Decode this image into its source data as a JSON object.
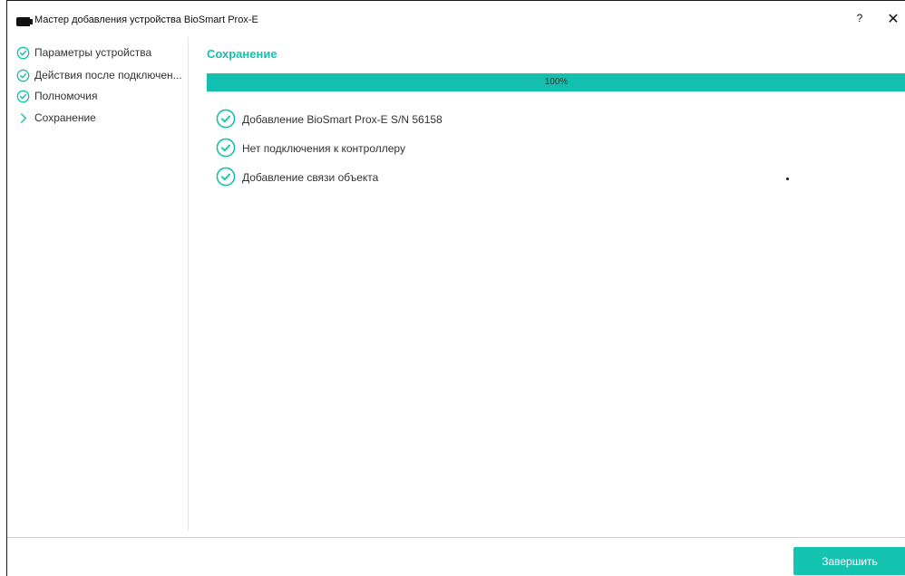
{
  "window": {
    "title": "Мастер добавления устройства BioSmart Prox-E",
    "help_label": "?",
    "close_label": "✕"
  },
  "sidebar": {
    "steps": [
      {
        "label": "Параметры устройства",
        "state": "done",
        "icon": "check-circle-icon"
      },
      {
        "label": "Действия после подключен...",
        "state": "done",
        "icon": "check-circle-icon"
      },
      {
        "label": "Полномочия",
        "state": "done",
        "icon": "check-circle-icon"
      },
      {
        "label": "Сохранение",
        "state": "current",
        "icon": "chevron-right-icon"
      }
    ]
  },
  "main": {
    "section_title": "Сохранение",
    "progress": {
      "value": 100,
      "label": "100%"
    },
    "tasks": [
      {
        "label": "Добавление BioSmart Prox-E S/N 56158",
        "status": "done",
        "icon": "check-circle-icon"
      },
      {
        "label": "Нет подключения к контроллеру",
        "status": "done",
        "icon": "check-circle-icon"
      },
      {
        "label": "Добавление связи объекта",
        "status": "done",
        "icon": "check-circle-icon"
      }
    ]
  },
  "footer": {
    "finish_label": "Завершить"
  },
  "colors": {
    "accent": "#15bfae",
    "progress_fill": "#13bfae",
    "button_bg": "#15c3b1",
    "text": "#333333"
  }
}
